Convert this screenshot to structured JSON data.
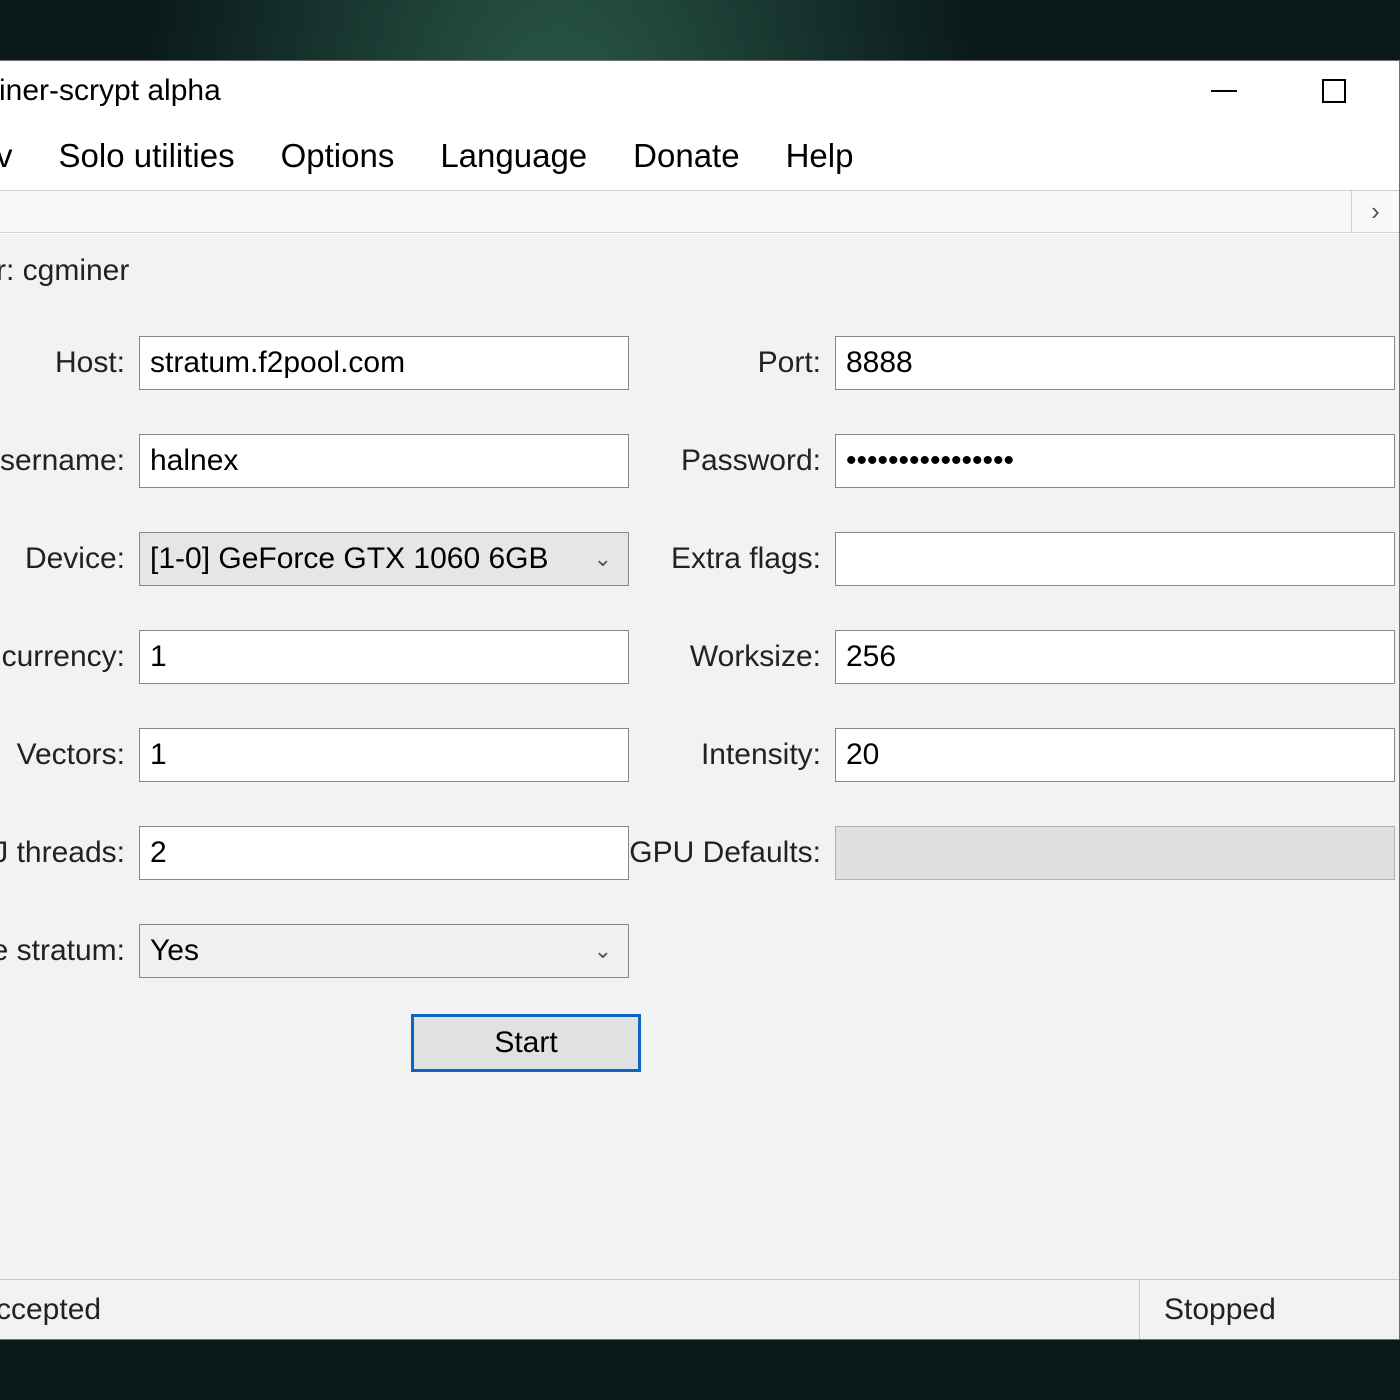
{
  "window": {
    "title": "iner-scrypt alpha"
  },
  "menubar": {
    "items": [
      "v",
      "Solo utilities",
      "Options",
      "Language",
      "Donate",
      "Help"
    ]
  },
  "miner_line": "r: cgminer",
  "form": {
    "host_label": "Host:",
    "host_value": "stratum.f2pool.com",
    "port_label": "Port:",
    "port_value": "8888",
    "username_label": "Jsername:",
    "username_value": "halnex",
    "password_label": "Password:",
    "password_value": "••••••••••••••••",
    "device_label": "Device:",
    "device_value": "[1-0] GeForce GTX 1060 6GB",
    "extraflags_label": "Extra flags:",
    "extraflags_value": "",
    "concurrency_label": "ncurrency:",
    "concurrency_value": "1",
    "worksize_label": "Worksize:",
    "worksize_value": "256",
    "vectors_label": "Vectors:",
    "vectors_value": "1",
    "intensity_label": "Intensity:",
    "intensity_value": "20",
    "threads_label": "J threads:",
    "threads_value": "2",
    "gpudefaults_label": "GPU Defaults:",
    "stratum_label": "e stratum:",
    "stratum_value": "Yes",
    "start_button": "Start"
  },
  "status": {
    "left": "ccepted",
    "right": "Stopped"
  }
}
